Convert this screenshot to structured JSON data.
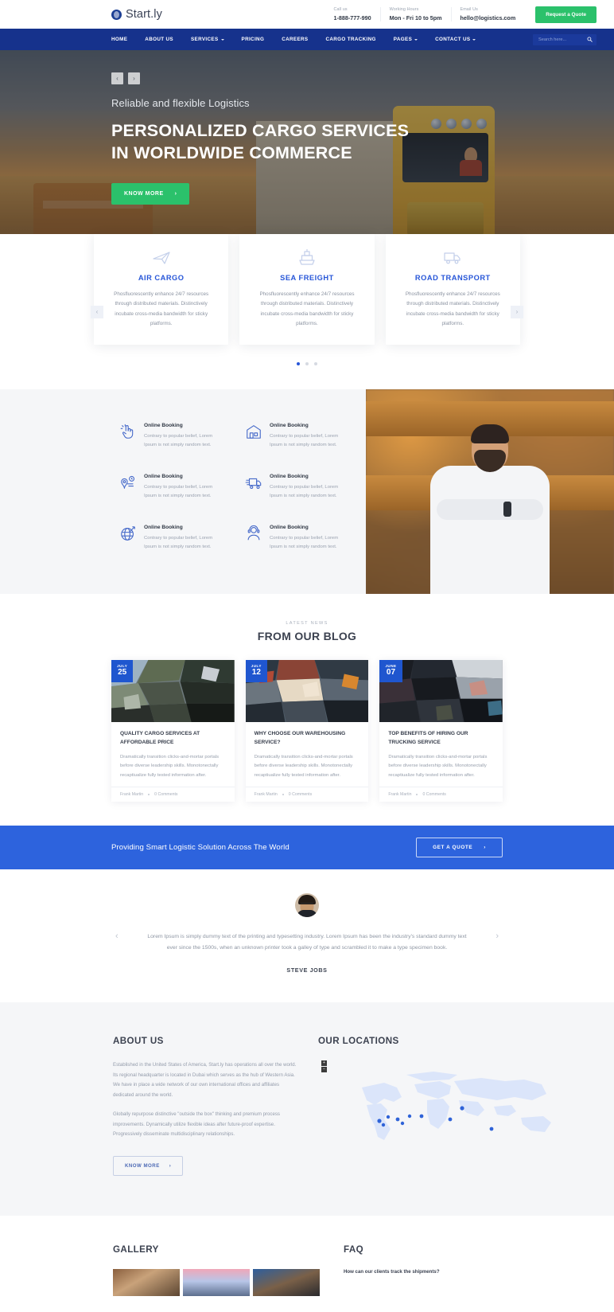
{
  "topbar": {
    "brand": "Start.ly",
    "info": [
      {
        "label": "Call us",
        "value": "1-888-777-990"
      },
      {
        "label": "Working Hours",
        "value": "Mon - Fri 10 to 5pm"
      },
      {
        "label": "Email Us",
        "value": "hello@logistics.com"
      }
    ],
    "quote_button": "Request a Quote"
  },
  "nav": {
    "items": [
      {
        "label": "HOME",
        "caret": false
      },
      {
        "label": "ABOUT US",
        "caret": false
      },
      {
        "label": "SERVICES",
        "caret": true
      },
      {
        "label": "PRICING",
        "caret": false
      },
      {
        "label": "CAREERS",
        "caret": false
      },
      {
        "label": "CARGO TRACKING",
        "caret": false
      },
      {
        "label": "PAGES",
        "caret": true
      },
      {
        "label": "CONTACT US",
        "caret": true
      }
    ],
    "search_placeholder": "Search here...",
    "search_value": ""
  },
  "hero": {
    "prev": "‹",
    "next": "›",
    "subtitle": "Reliable and flexible Logistics",
    "title_line1": "PERSONALIZED CARGO SERVICES",
    "title_line2": "IN WORLDWIDE COMMERCE",
    "cta": "KNOW MORE",
    "cta_arrow": "›"
  },
  "services": {
    "prev": "‹",
    "next": "›",
    "cards": [
      {
        "icon": "airplane-icon",
        "title": "AIR CARGO",
        "desc": "Phosfluorescently enhance 24/7 resources through distributed materials. Distinctively incubate cross-media bandwidth for sticky platforms."
      },
      {
        "icon": "ship-icon",
        "title": "SEA FREIGHT",
        "desc": "Phosfluorescently enhance 24/7 resources through distributed materials. Distinctively incubate cross-media bandwidth for sticky platforms."
      },
      {
        "icon": "truck-icon",
        "title": "ROAD TRANSPORT",
        "desc": "Phosfluorescently enhance 24/7 resources through distributed materials. Distinctively incubate cross-media bandwidth for sticky platforms."
      }
    ],
    "dots": 3,
    "active_dot": 0
  },
  "features": [
    {
      "icon": "click-hand-icon",
      "title": "Online Booking",
      "desc": "Contrary to popular belief, Lorem Ipsum is not simply random text."
    },
    {
      "icon": "warehouse-icon",
      "title": "Online Booking",
      "desc": "Contrary to popular belief, Lorem Ipsum is not simply random text."
    },
    {
      "icon": "location-pin-icon",
      "title": "Online Booking",
      "desc": "Contrary to popular belief, Lorem Ipsum is not simply random text."
    },
    {
      "icon": "delivery-truck-icon",
      "title": "Online Booking",
      "desc": "Contrary to popular belief, Lorem Ipsum is not simply random text."
    },
    {
      "icon": "globe-icon",
      "title": "Online Booking",
      "desc": "Contrary to popular belief, Lorem Ipsum is not simply random text."
    },
    {
      "icon": "support-agent-icon",
      "title": "Online Booking",
      "desc": "Contrary to popular belief, Lorem Ipsum is not simply random text."
    }
  ],
  "blog": {
    "kicker": "LATEST NEWS",
    "title": "FROM OUR BLOG",
    "posts": [
      {
        "month": "JULY",
        "day": "25",
        "title": "QUALITY CARGO SERVICES AT AFFORDABLE PRICE",
        "excerpt": "Dramatically transition clicks-and-mortar portals before diverse leadership skills. Monotonectally recaptiualize fully tested information after.",
        "author": "Frank Martin",
        "comments": "0 Comments"
      },
      {
        "month": "JULY",
        "day": "12",
        "title": "WHY CHOOSE OUR WAREHOUSING SERVICE?",
        "excerpt": "Dramatically transition clicks-and-mortar portals before diverse leadership skills. Monotonectally recaptiualize fully tested information after.",
        "author": "Frank Martin",
        "comments": "0 Comments"
      },
      {
        "month": "JUNE",
        "day": "07",
        "title": "TOP BENEFITS OF HIRING OUR TRUCKING SERVICE",
        "excerpt": "Dramatically transition clicks-and-mortar portals before diverse leadership skills. Monotonectally recaptiualize fully tested information after.",
        "author": "Frank Martin",
        "comments": "0 Comments"
      }
    ]
  },
  "cta_banner": {
    "text": "Providing Smart Logistic Solution Across The World",
    "button": "GET A QUOTE",
    "button_arrow": "›"
  },
  "testimonial": {
    "prev": "‹",
    "next": "›",
    "quote": "Lorem Ipsum is simply dummy text of the printing and typesetting industry. Lorem Ipsum has been the industry's standard dummy text ever since the 1500s, when an unknown printer took a galley of type and scrambled it to make a type specimen book.",
    "author": "STEVE JOBS"
  },
  "about": {
    "title": "ABOUT US",
    "paragraph1": "Established in the United States of America, Start.ly has operations all over the world. Its regional headquarter is located in Dubai which serves as the hub of Western Asia. We have in place a wide network of our own international offices and affiliates dedicated around the world.",
    "paragraph2": "Globally repurpose distinctive \"outside the box\" thinking and premium process improvements. Dynamically utilize flexible ideas after future-proof expertise. Progressively disseminate multidisciplinary relationships.",
    "button": "KNOW MORE",
    "button_arrow": "›"
  },
  "locations": {
    "title": "OUR LOCATIONS",
    "zoom_in": "+",
    "zoom_out": "−",
    "markers": [
      {
        "x": 17,
        "y": 64
      },
      {
        "x": 21,
        "y": 59
      },
      {
        "x": 25,
        "y": 62
      },
      {
        "x": 30,
        "y": 59
      },
      {
        "x": 35,
        "y": 58
      },
      {
        "x": 19,
        "y": 68
      },
      {
        "x": 27,
        "y": 66
      },
      {
        "x": 52,
        "y": 50
      },
      {
        "x": 47,
        "y": 62
      },
      {
        "x": 64,
        "y": 72
      }
    ]
  },
  "gallery": {
    "title": "GALLERY",
    "items": [
      "gallery-image-1",
      "gallery-image-2",
      "gallery-image-3"
    ]
  },
  "faq": {
    "title": "FAQ",
    "questions": [
      "How can our clients track the shipments?"
    ]
  },
  "colors": {
    "nav_blue": "#16328c",
    "accent_blue": "#2756d8",
    "cta_blue": "#2d63dd",
    "green": "#2bc16b",
    "light_bg": "#f5f6f8"
  }
}
